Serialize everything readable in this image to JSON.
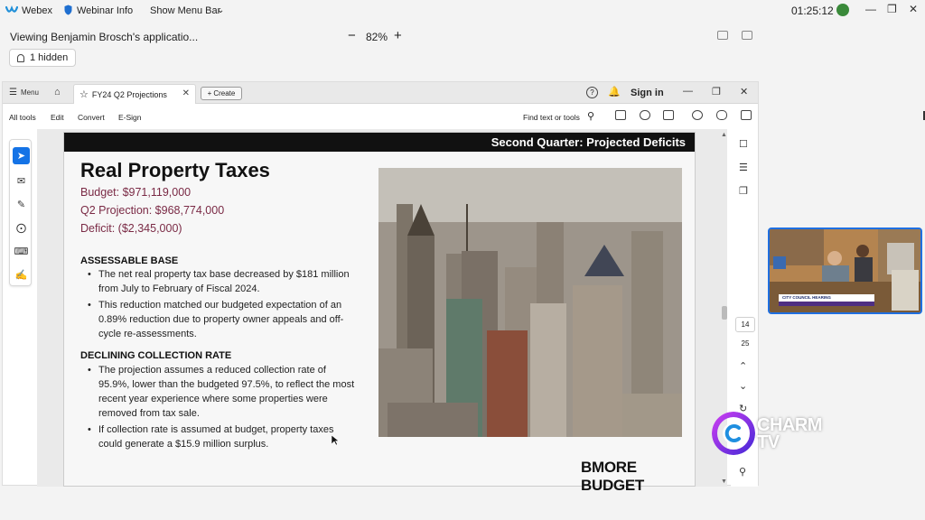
{
  "webex": {
    "app_name": "Webex",
    "webinar_info": "Webinar Info",
    "show_menu_bar": "Show Menu Bar",
    "time": "01:25:12"
  },
  "share": {
    "viewing_text": "Viewing Benjamin Brosch's applicatio...",
    "zoom": "82%",
    "hidden_label": "1 hidden"
  },
  "acrobat": {
    "menu_label": "Menu",
    "tab_title": "FY24 Q2 Projections",
    "create_label": "Create",
    "sign_in": "Sign in",
    "menus": [
      "All tools",
      "Edit",
      "Convert",
      "E-Sign"
    ],
    "find_label": "Find text or tools",
    "page_current": "14",
    "page_total": "25"
  },
  "slide": {
    "band_title": "Second Quarter: Projected Deficits",
    "title": "Real Property Taxes",
    "budget": "Budget: $971,119,000",
    "q2_projection": "Q2 Projection: $968,774,000",
    "deficit": "Deficit: ($2,345,000)",
    "section1_heading": "ASSESSABLE BASE",
    "section1_bullets": [
      "The net real property tax base decreased by $181 million from July to February of Fiscal 2024.",
      "This reduction matched our budgeted expectation of an 0.89% reduction due to property owner appeals and off-cycle re-assessments."
    ],
    "section2_heading": "DECLINING COLLECTION RATE",
    "section2_bullets": [
      "The projection assumes a reduced collection rate of 95.9%, lower than the budgeted 97.5%, to reflect the most recent year experience where some properties were removed from tax sale.",
      "If collection rate is assumed at budget, property taxes could generate a $15.9 million surplus."
    ],
    "logo_text": "BMORE BUDGET"
  },
  "video": {
    "lower_third": "CITY COUNCIL HEARING"
  },
  "watermark": {
    "line1": "CHARM",
    "line2": "TV"
  },
  "colors": {
    "accent_blue": "#1473e6",
    "figure_maroon": "#7a2a45",
    "charm_purple": "#6a2bb8"
  }
}
